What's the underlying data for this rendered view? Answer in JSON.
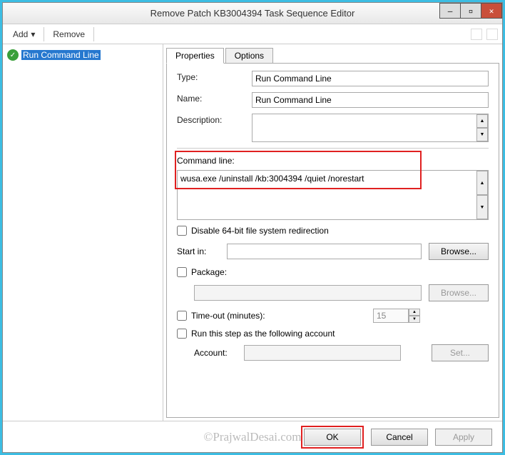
{
  "window": {
    "title": "Remove Patch KB3004394 Task Sequence Editor"
  },
  "toolbar": {
    "add": "Add",
    "remove": "Remove"
  },
  "tree": {
    "item1": "Run Command Line"
  },
  "tabs": {
    "properties": "Properties",
    "options": "Options"
  },
  "props": {
    "type_label": "Type:",
    "type_value": "Run Command Line",
    "name_label": "Name:",
    "name_value": "Run Command Line",
    "desc_label": "Description:",
    "cmd_label": "Command line:",
    "cmd_value": "wusa.exe /uninstall /kb:3004394 /quiet /norestart",
    "disable64": "Disable 64-bit file system redirection",
    "startin_label": "Start in:",
    "browse": "Browse...",
    "package": "Package:",
    "timeout": "Time-out (minutes):",
    "timeout_value": "15",
    "runas": "Run this step as the following account",
    "account_label": "Account:",
    "set": "Set..."
  },
  "footer": {
    "ok": "OK",
    "cancel": "Cancel",
    "apply": "Apply"
  },
  "watermark": "©PrajwalDesai.com"
}
